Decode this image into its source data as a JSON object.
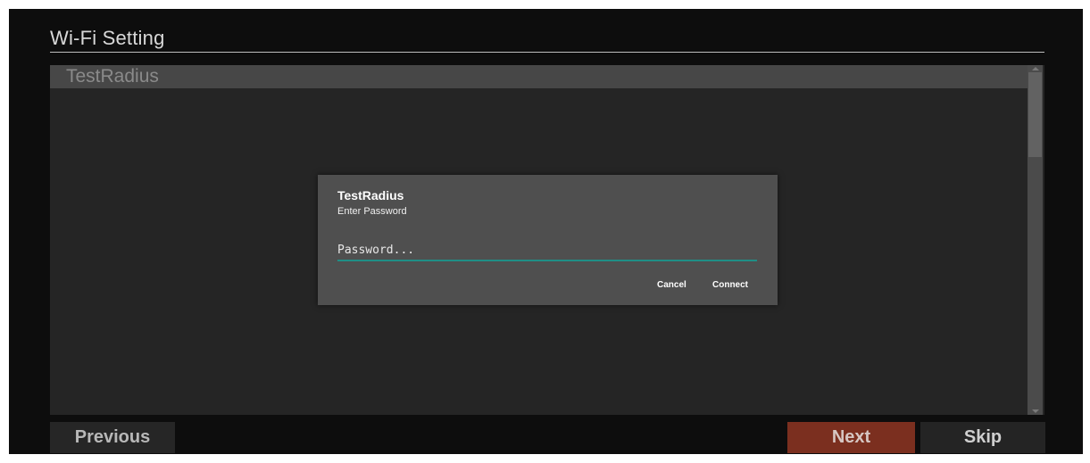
{
  "window": {
    "title": "Wi-Fi Setting"
  },
  "network_list": {
    "items": [
      {
        "label": "TestRadius"
      }
    ]
  },
  "password_dialog": {
    "title": "TestRadius",
    "subtitle": "Enter Password",
    "password_value": "",
    "password_placeholder": "Password...",
    "cancel_label": "Cancel",
    "connect_label": "Connect",
    "accent_color": "#1f8f86"
  },
  "navigation": {
    "previous_label": "Previous",
    "next_label": "Next",
    "skip_label": "Skip",
    "next_color": "#7b2f1f"
  }
}
